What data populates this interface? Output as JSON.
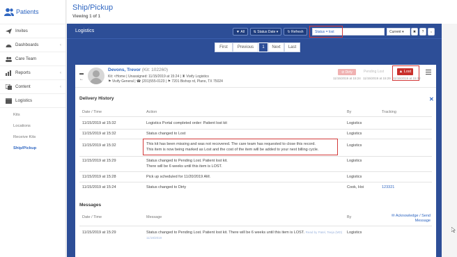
{
  "sidebar": {
    "brand": "Patients",
    "items": [
      {
        "label": "Invites"
      },
      {
        "label": "Dashboards"
      },
      {
        "label": "Care Team"
      },
      {
        "label": "Reports"
      },
      {
        "label": "Content"
      },
      {
        "label": "Logistics"
      }
    ],
    "sub_items": [
      {
        "label": "Kits"
      },
      {
        "label": "Locations"
      },
      {
        "label": "Receive Kits"
      },
      {
        "label": "Ship/Pickup"
      }
    ]
  },
  "header": {
    "title": "Ship/Pickup",
    "subtitle": "Viewing 1 of 1"
  },
  "panel": {
    "title": "Logistics",
    "buttons": {
      "all": "All",
      "status_date": "Status Date",
      "refresh": "Refresh"
    },
    "search_value": "Status = lost",
    "current": "Current",
    "pager": {
      "first": "First",
      "previous": "Previous",
      "page": "1",
      "next": "Next",
      "last": "Last"
    }
  },
  "patient": {
    "name": "Devons, Trevor",
    "kit": "(Kit: 102260)",
    "line1": "Kit: <Home | Unassigned: 11/15/2019 at 15:24 | ♜ Vivify Logistics",
    "line2": "⚑ Vivify General | ☎ (201)555-0123 | ⚑ 7201 Bishop rd, Plano, TX 75024",
    "status_dirty": "Dirty",
    "status_pending": "Pending Lost",
    "status_lost": "Lost",
    "ts1": "11/15/2019 at 15:24",
    "ts2": "11/15/2019 at 15:29",
    "ts3": "11/15/2019 at 15:32"
  },
  "delivery": {
    "title": "Delivery History",
    "headers": {
      "date": "Date / Time",
      "action": "Action",
      "by": "By",
      "tracking": "Tracking"
    },
    "rows": [
      {
        "date": "11/15/2019 at 15:32",
        "action": "Logistics Portal completed order: Patient lost kit",
        "action2": "",
        "by": "Logistics",
        "tracking": ""
      },
      {
        "date": "11/15/2019 at 15:32",
        "action": "Status changed to Lost",
        "action2": "",
        "by": "Logistics",
        "tracking": ""
      },
      {
        "date": "11/15/2019 at 15:32",
        "action": "This kit has been missing and was not recovered. The care team has requested to close this record.",
        "action2": "This item is now being marked as Lost and the cost of the item will be added to your next billing cycle.",
        "by": "Logistics",
        "tracking": ""
      },
      {
        "date": "11/15/2019 at 15:29",
        "action": "Status changed to Pending Lost. Patient lost kit.",
        "action2": "There will be 6 weeks until this item is LOST.",
        "by": "Logistics",
        "tracking": ""
      },
      {
        "date": "11/15/2019 at 15:28",
        "action": "Pick up scheduled for 11/20/2019 AM.",
        "action2": "",
        "by": "Logistics",
        "tracking": ""
      },
      {
        "date": "11/15/2019 at 15:24",
        "action": "Status changed to Dirty",
        "action2": "",
        "by": "Cook, Hoi",
        "tracking": "123321"
      }
    ]
  },
  "messages": {
    "title": "Messages",
    "headers": {
      "date": "Date / Time",
      "message": "Message",
      "by": "By"
    },
    "acknowledge": "Acknowledge / Send Message",
    "rows": [
      {
        "date": "11/15/2019 at 15:29",
        "message": "Status changed to Pending Lost. Patient lost kit. There will be 6 weeks until this item is LOST.",
        "note": "Read by Patel, Teeja (MD)",
        "note2": "11/19/2019",
        "by": "Logistics"
      }
    ]
  },
  "colors": {
    "brand": "#2f66c1",
    "panel": "#2d4e97",
    "lost": "#c9302c",
    "highlight": "#d23a3a"
  }
}
